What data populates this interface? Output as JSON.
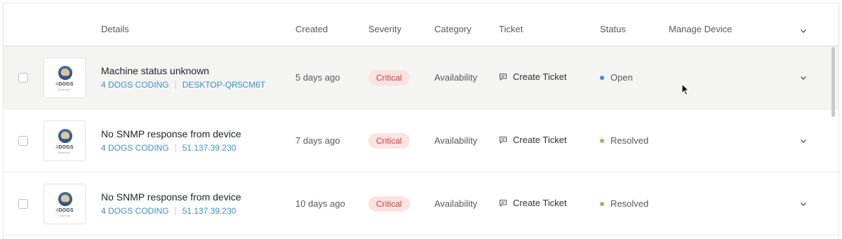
{
  "header": {
    "details": "Details",
    "created": "Created",
    "severity": "Severity",
    "category": "Category",
    "ticket": "Ticket",
    "status": "Status",
    "manage_device": "Manage Device"
  },
  "logo": {
    "word_a": "4",
    "word_b": "DOGS",
    "sub": "CODING"
  },
  "colors": {
    "link": "#3d8fcf",
    "critical_bg": "#fbe3e1",
    "critical_text": "#c9413a",
    "open_dot": "#3d8fcf",
    "resolved_dot": "#8cbf5a",
    "row_highlight": "#f4f4f2"
  },
  "rows": [
    {
      "title": "Machine status unknown",
      "org": "4 DOGS CODING",
      "device": "DESKTOP-QR5CM6T",
      "created": "5 days ago",
      "severity": "Critical",
      "category": "Availability",
      "ticket": "Create Ticket",
      "status": "Open"
    },
    {
      "title": "No SNMP response from device",
      "org": "4 DOGS CODING",
      "device": "51.137.39.230",
      "created": "7 days ago",
      "severity": "Critical",
      "category": "Availability",
      "ticket": "Create Ticket",
      "status": "Resolved"
    },
    {
      "title": "No SNMP response from device",
      "org": "4 DOGS CODING",
      "device": "51.137.39.230",
      "created": "10 days ago",
      "severity": "Critical",
      "category": "Availability",
      "ticket": "Create Ticket",
      "status": "Resolved"
    }
  ]
}
